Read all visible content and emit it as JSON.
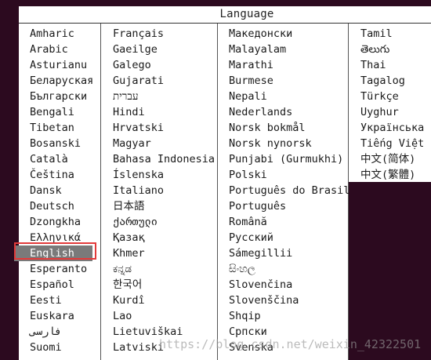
{
  "dialog": {
    "title": "Language"
  },
  "columns": [
    [
      "Amharic",
      "Arabic",
      "Asturianu",
      "Беларуская",
      "Български",
      "Bengali",
      "Tibetan",
      "Bosanski",
      "Català",
      "Čeština",
      "Dansk",
      "Deutsch",
      "Dzongkha",
      "Ελληνικά",
      "English",
      "Esperanto",
      "Español",
      "Eesti",
      "Euskara",
      "فارسی",
      "Suomi"
    ],
    [
      "Français",
      "Gaeilge",
      "Galego",
      "Gujarati",
      "עברית",
      "Hindi",
      "Hrvatski",
      "Magyar",
      "Bahasa Indonesia",
      "Íslenska",
      "Italiano",
      "日本語",
      "ქართული",
      "Қазақ",
      "Khmer",
      "ಕನ್ನಡ",
      "한국어",
      "Kurdî",
      "Lao",
      "Lietuviškai",
      "Latviski"
    ],
    [
      "Македонски",
      "Malayalam",
      "Marathi",
      "Burmese",
      "Nepali",
      "Nederlands",
      "Norsk bokmål",
      "Norsk nynorsk",
      "Punjabi (Gurmukhi)",
      "Polski",
      "Português do Brasil",
      "Português",
      "Română",
      "Русский",
      "Sámegillii",
      "සිංහල",
      "Slovenčina",
      "Slovenščina",
      "Shqip",
      "Српски",
      "Svenska"
    ],
    [
      "Tamil",
      "తెలుగు",
      "Thai",
      "Tagalog",
      "Türkçe",
      "Uyghur",
      "Українська",
      "Tiếng Việt",
      "中文(简体)",
      "中文(繁體)"
    ]
  ],
  "selected": "English",
  "watermark": "https://blog.csdn.net/weixin_42322501"
}
